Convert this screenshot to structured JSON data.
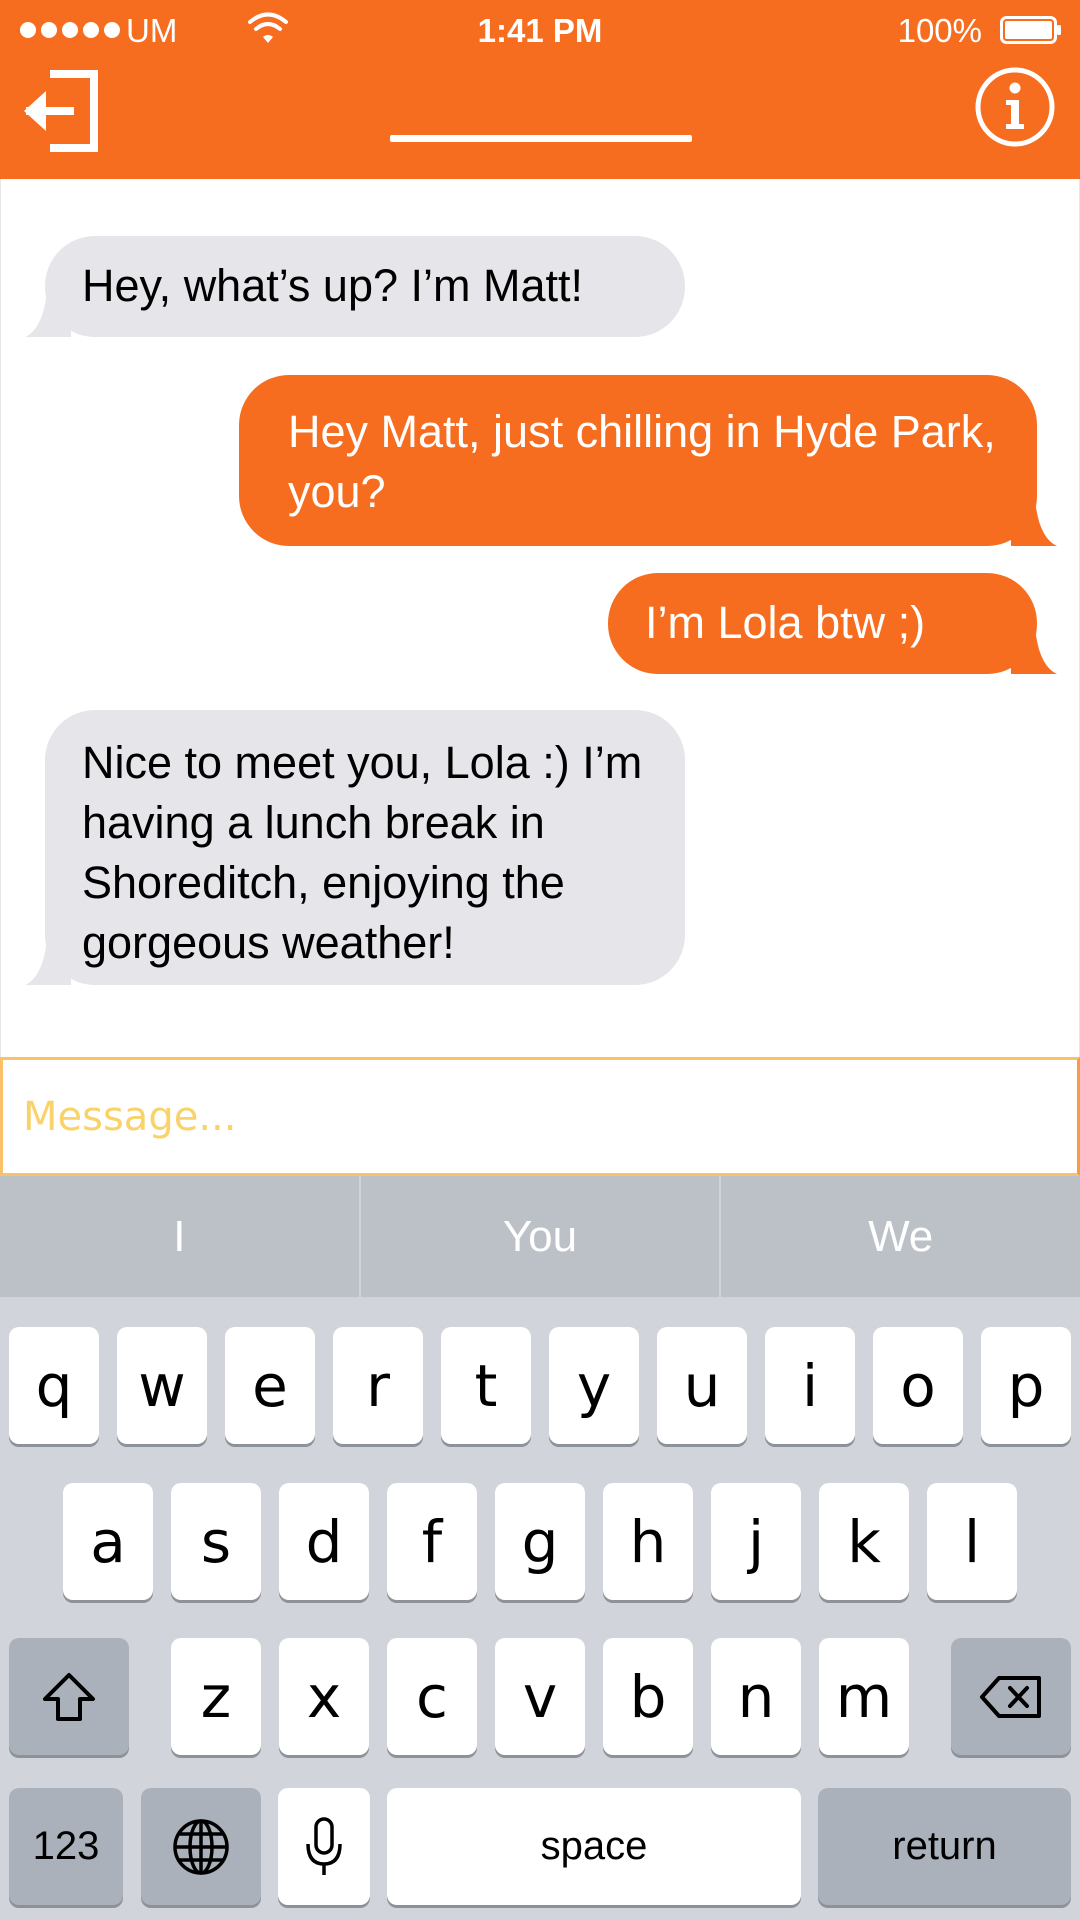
{
  "status_bar": {
    "carrier": "UM",
    "time": "1:41 PM",
    "battery_percent": "100%",
    "signal_bars": 5,
    "battery_level": 1.0
  },
  "header": {
    "exit_icon": "exit-door-icon",
    "info_icon": "info-icon",
    "title": "",
    "accent_color": "#f76d1f"
  },
  "messages": [
    {
      "sender": "incoming",
      "text": "Hey, what’s up? I’m Matt!"
    },
    {
      "sender": "outgoing",
      "text": "Hey Matt, just chilling in Hyde Park, you?"
    },
    {
      "sender": "outgoing",
      "text": "I’m Lola btw ;)"
    },
    {
      "sender": "incoming",
      "text": "Nice to meet you, Lola :) I’m having a lunch break in Shoreditch, enjoying the gorgeous weather!"
    }
  ],
  "composer": {
    "placeholder": "Message...",
    "value": ""
  },
  "keyboard": {
    "suggestions": [
      "I",
      "You",
      "We"
    ],
    "row1": [
      "q",
      "w",
      "e",
      "r",
      "t",
      "y",
      "u",
      "i",
      "o",
      "p"
    ],
    "row2": [
      "a",
      "s",
      "d",
      "f",
      "g",
      "h",
      "j",
      "k",
      "l"
    ],
    "row3": [
      "z",
      "x",
      "c",
      "v",
      "b",
      "n",
      "m"
    ],
    "numbers_key": "123",
    "space_key": "space",
    "return_key": "return",
    "shift_icon": "shift-arrow-icon",
    "delete_icon": "backspace-icon",
    "globe_icon": "globe-icon",
    "mic_icon": "microphone-icon"
  }
}
